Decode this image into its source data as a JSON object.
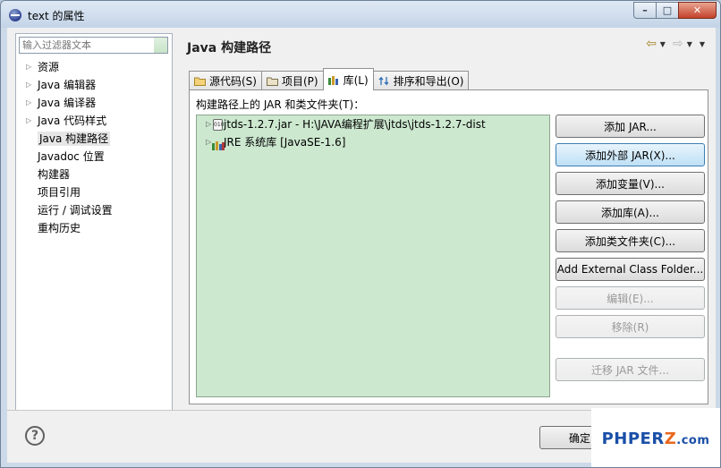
{
  "window": {
    "title": "text 的属性",
    "minimize": "–",
    "maximize": "□",
    "close": "✕"
  },
  "left": {
    "filter_placeholder": "输入过滤器文本",
    "items": [
      {
        "label": "资源",
        "arrow": true
      },
      {
        "label": "Java 编辑器",
        "arrow": true
      },
      {
        "label": "Java 编译器",
        "arrow": true
      },
      {
        "label": "Java 代码样式",
        "arrow": true
      },
      {
        "label": "Java 构建路径",
        "arrow": false,
        "selected": true
      },
      {
        "label": "Javadoc 位置",
        "arrow": false
      },
      {
        "label": "构建器",
        "arrow": false
      },
      {
        "label": "项目引用",
        "arrow": false
      },
      {
        "label": "运行 / 调试设置",
        "arrow": false
      },
      {
        "label": "重构历史",
        "arrow": false
      }
    ]
  },
  "right": {
    "title": "Java 构建路径",
    "tabs": [
      {
        "label": "源代码(S)",
        "icon": "folder-source-icon"
      },
      {
        "label": "项目(P)",
        "icon": "project-icon"
      },
      {
        "label": "库(L)",
        "icon": "library-icon",
        "active": true
      },
      {
        "label": "排序和导出(O)",
        "icon": "order-export-icon"
      }
    ],
    "panel_label": "构建路径上的 JAR 和类文件夹(T)：",
    "entries": [
      {
        "label": "jtds-1.2.7.jar  -  H:\\JAVA编程扩展\\jtds\\jtds-1.2.7-dist",
        "icon": "jar-icon",
        "icon_text": "010"
      },
      {
        "label": "JRE 系统库 [JavaSE-1.6]",
        "icon": "library-icon"
      }
    ],
    "buttons": {
      "add_jar": "添加 JAR...",
      "add_external_jar": "添加外部 JAR(X)...",
      "add_variable": "添加变量(V)...",
      "add_library": "添加库(A)...",
      "add_class_folder": "添加类文件夹(C)...",
      "add_external_class_folder": "Add External Class Folder...",
      "edit": "编辑(E)...",
      "remove": "移除(R)",
      "migrate_jar": "迁移 JAR 文件..."
    }
  },
  "footer": {
    "help": "?",
    "ok": "确定"
  },
  "watermark": {
    "part1": "PHPER",
    "part2": "Z",
    "part3": ".com"
  }
}
